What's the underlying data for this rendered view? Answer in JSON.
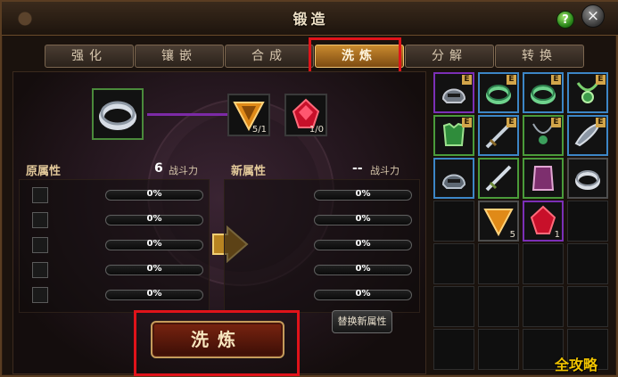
{
  "window": {
    "title": "锻造"
  },
  "tabs": [
    {
      "label": "强化"
    },
    {
      "label": "镶嵌"
    },
    {
      "label": "合成"
    },
    {
      "label": "洗炼",
      "active": true
    },
    {
      "label": "分解"
    },
    {
      "label": "转换"
    }
  ],
  "materials": [
    {
      "icon": "triangle-gem-icon",
      "qty": "5/1"
    },
    {
      "icon": "red-gem-icon",
      "qty": "1/0"
    }
  ],
  "original": {
    "label": "原属性",
    "power_value": "6",
    "power_label": "战斗力",
    "rows": [
      "0%",
      "0%",
      "0%",
      "0%",
      "0%"
    ]
  },
  "new": {
    "label": "新属性",
    "power_value": "--",
    "power_label": "战斗力",
    "rows": [
      "0%",
      "0%",
      "0%",
      "0%",
      "0%"
    ]
  },
  "buttons": {
    "replace": "替换新属性",
    "wash": "洗炼"
  },
  "inventory": {
    "items": [
      {
        "icon": "helmet-icon",
        "badge": "E",
        "color": "#7b2fb6"
      },
      {
        "icon": "ring-icon",
        "badge": "E",
        "color": "#3c86c6"
      },
      {
        "icon": "ring-icon",
        "badge": "E",
        "color": "#3c86c6"
      },
      {
        "icon": "amulet-icon",
        "badge": "E",
        "color": "#3c86c6"
      },
      {
        "icon": "armor-icon",
        "badge": "E",
        "color": "#4a9b3a"
      },
      {
        "icon": "sword-icon",
        "badge": "E",
        "color": "#3c86c6"
      },
      {
        "icon": "necklace-icon",
        "badge": "E",
        "color": "#4a9b3a"
      },
      {
        "icon": "feather-icon",
        "badge": "E",
        "color": "#3c86c6"
      },
      {
        "icon": "helmet-icon",
        "badge": "",
        "color": "#3c86c6"
      },
      {
        "icon": "sword-icon",
        "badge": "",
        "color": "#4a9b3a"
      },
      {
        "icon": "armor-icon",
        "badge": "",
        "color": "#4a9b3a"
      },
      {
        "icon": "ring-icon",
        "badge": "",
        "color": "#4d4d4d"
      },
      {
        "icon": "triangle-gem-icon",
        "badge": "",
        "qty": "5",
        "color": "#4d4d4d",
        "col": 1,
        "row": 3
      },
      {
        "icon": "red-gem-icon",
        "badge": "",
        "qty": "1",
        "color": "#7b2fb6",
        "col": 2,
        "row": 3
      }
    ]
  },
  "watermark": "全攻略"
}
